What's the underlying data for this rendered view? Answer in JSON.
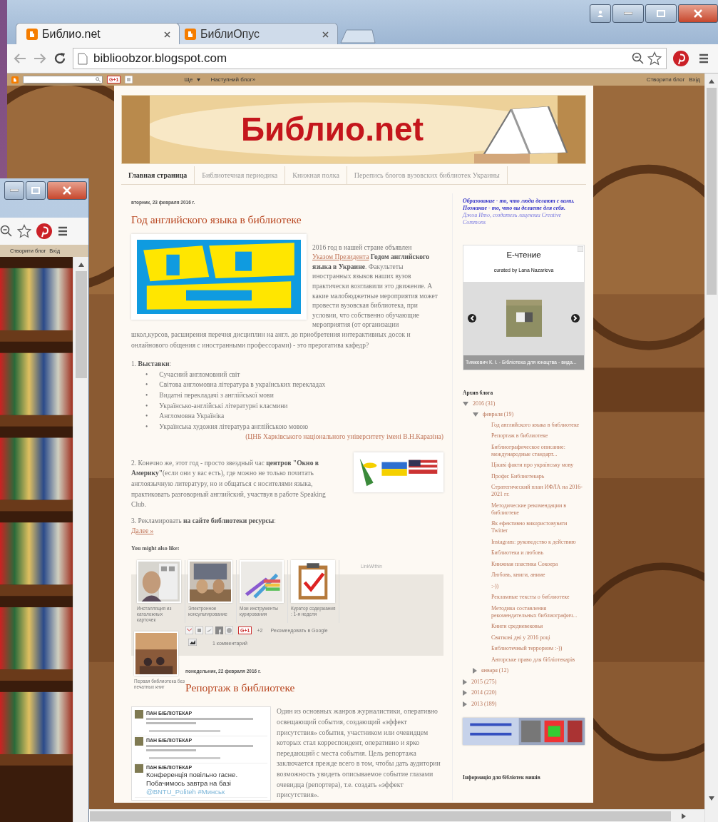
{
  "back_window": {
    "navbar_links": [
      "Створити блог",
      "Вхід"
    ]
  },
  "tabs": [
    {
      "title": "Библио.net",
      "selected": true
    },
    {
      "title": "БиблиОпус",
      "selected": false
    }
  ],
  "address": "biblioobzor.blogspot.com",
  "blogger_bar": {
    "gplus": "G+1",
    "more": "Ще",
    "next_blog": "Наступний блог»",
    "create": "Створити блог",
    "sign_in": "Вхід"
  },
  "blog": {
    "title": "Библио.net",
    "pages": [
      {
        "label": "Главная страница",
        "selected": true
      },
      {
        "label": "Библиотечная периодика",
        "selected": false
      },
      {
        "label": "Книжная полка",
        "selected": false
      },
      {
        "label": "Перепись блогов вузовских библиотек Украины",
        "selected": false
      }
    ],
    "posts": [
      {
        "date": "вторник, 23 февраля 2016 г.",
        "title": "Год английского языка в библиотеке",
        "intro_before": "2016 год в нашей стране объявлен",
        "intro_link": "Указом Президента",
        "intro_after": "**Годом английского языка в Украине**. Факультеты иностранных языков наших вузов практически возглавили это движение. А какие малобюджетные мероприятия может провести вузовская библиотека, при условии, что собственно обучающие мероприятия (от организации",
        "intro_continued": "школ,курсов, расширения перечня дисциплин на англ. до приобретения интерактивных досок и онлайнового общения с иностранными профессорами) - это прерогатива кафедр?",
        "list_heading": "1. **Выставки**:",
        "list": [
          {
            "marker": "•",
            "text": "Сучасний англомовний світ"
          },
          {
            "marker": "•",
            "text": "Світова англомовна література в українських перекладах"
          },
          {
            "marker": "•",
            "text": "Видатні перекладачі з англійської мови"
          },
          {
            "marker": "•",
            "text": "Українсько-англійські літературні класмини"
          },
          {
            "marker": "•",
            "text": "Англомовна Україніка"
          },
          {
            "marker": "•",
            "text": "Українська художня література англійською мовою"
          }
        ],
        "source": "(ЦНБ Харківського національного університету імені В.Н.Каразіна)",
        "paragraphs": [
          "2. Конечно же, этот год - просто звездный час **центров \"Окно в Америку\"**(если они у вас есть), где можно не только почитать англоязычную литературу, но и общаться с носителями языка, практиковать разговорный  английский, участвуя в работе Speaking Club.",
          "3. Рекламировать **на сайте  библиотеки ресурсы**:"
        ],
        "more": "Далее »",
        "related_heading": "You might also like:",
        "related": [
          {
            "caption": "Инсталляция из каталожных карточек"
          },
          {
            "caption": "Электронное консультирование"
          },
          {
            "caption": "Мои инструменты курирования"
          },
          {
            "caption": "Куратор содержания : 1-я неделя"
          },
          {
            "caption": "Первая библиотека без печатных книг"
          }
        ],
        "related_credit": "LinkWithin",
        "share": {
          "gplus": "G+1",
          "plus_count": "+2",
          "recommend": "Рекомендовать в Google",
          "comments": "1 комментарий"
        }
      },
      {
        "date": "понедельник, 22 февраля 2016 г.",
        "title": "Репортаж в библиотеке",
        "tweets": [
          {
            "author": "ПАН БІБЛІОТЕКАР"
          },
          {
            "author": "ПАН БІБЛІОТЕКАР"
          },
          {
            "author": "ПАН БІБЛІОТЕКАР",
            "text": "Конференція повільно гасне. Побачимось завтра на базі",
            "tags": "@BNTU_Politeh #Минськ"
          }
        ],
        "body": "Один из основных жанров журналистики, оперативно освещающий события, создающий «эффект присутствия» события, участником или очевидцем которых стал корреспондент, оперативно и ярко передающий с места события. Цель репортажа заключается прежде всего в том, чтобы дать аудитории возможность увидеть описываемое событие глазами очевидца (репортера), т.е. создать «эффект присутствия»."
      }
    ],
    "sidebar": {
      "quote": "Образование - то, что люди делают с вами. Познание - то, что вы делаете для себя.",
      "quote_author": "Джои Ито, создатель лицензии Creative Commons",
      "widget": {
        "title": "Е-чтение",
        "curator": "curated by Lana Nazarieva",
        "caption": "Тимкевич К. І. - Бібліотека для юнацтва - вида..."
      },
      "archive_title": "Архив блога",
      "archive": [
        {
          "label": "2016",
          "count": "(31)",
          "expanded": true,
          "children": [
            {
              "label": "февраля",
              "count": "(19)",
              "expanded": true,
              "children": [
                {
                  "label": "Год английского языка в библиотеке"
                },
                {
                  "label": "Репортаж в библиотеке"
                },
                {
                  "label": "Библиографическое описание: международные стандарт..."
                },
                {
                  "label": "Цікаві факти про українську мову"
                },
                {
                  "label": "Профи: Библиотекарь"
                },
                {
                  "label": "Стратегический план ИФЛА на 2016-2021 гг."
                },
                {
                  "label": "Методические рекомендации в библиотеке"
                },
                {
                  "label": "Як ефективно використовувати Twitter"
                },
                {
                  "label": "Instagram: руководство к действию"
                },
                {
                  "label": "Библиотека и любовь"
                },
                {
                  "label": "Книжная пластика Сокоера"
                },
                {
                  "label": "Любовь, книги, аниме"
                },
                {
                  "label": ":-))"
                },
                {
                  "label": "Рекламные тексты о библиотеке"
                },
                {
                  "label": "Методика составления рекомендательных библиографич..."
                },
                {
                  "label": "Книги средневековья"
                },
                {
                  "label": "Святкові дні у 2016 році"
                },
                {
                  "label": "Библиотечный терроризм :-))"
                },
                {
                  "label": "Авторське право для бібліотекарів"
                }
              ]
            },
            {
              "label": "января",
              "count": "(12)",
              "expanded": false
            }
          ]
        },
        {
          "label": "2015",
          "count": "(275)",
          "expanded": false
        },
        {
          "label": "2014",
          "count": "(220)",
          "expanded": false
        },
        {
          "label": "2013",
          "count": "(189)",
          "expanded": false
        }
      ],
      "info_title": "Інформація для бібліотек вишів"
    }
  }
}
